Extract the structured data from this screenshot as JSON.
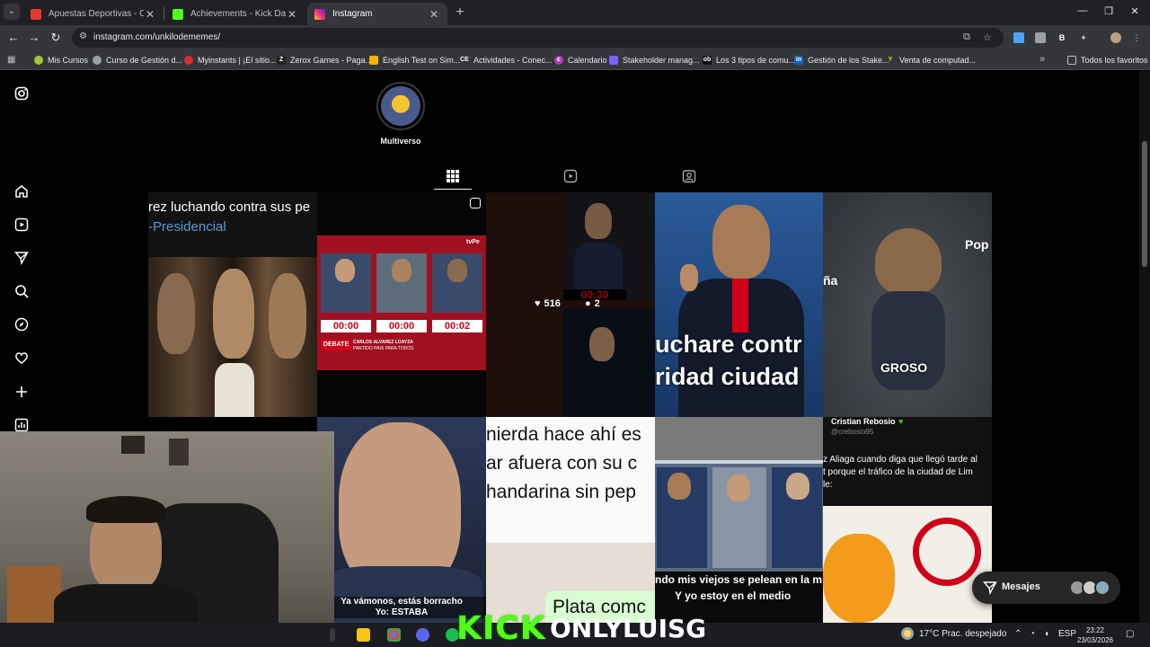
{
  "browser": {
    "tabs": [
      {
        "title": "Apuestas Deportivas - Casa de",
        "favicon_color": "#e53935",
        "active": false
      },
      {
        "title": "Achievements - Kick Dashboard",
        "favicon_color": "#53fc18",
        "active": false
      },
      {
        "title": "Instagram",
        "favicon_color": "#e1306c",
        "active": true
      }
    ],
    "url": "instagram.com/unkilodememes/",
    "bookmarks": [
      {
        "label": "Mis Cursos",
        "icon_color": "#a4c639",
        "glyph": ""
      },
      {
        "label": "Curso de Gestión d...",
        "icon_color": "#9aa0a6",
        "glyph": ""
      },
      {
        "label": "Myinstants | ¡El sitio...",
        "icon_color": "#d32f2f",
        "glyph": ""
      },
      {
        "label": "Zerox Games - Paga...",
        "icon_color": "#222222",
        "glyph": "Z"
      },
      {
        "label": "English Test on Sim...",
        "icon_color": "#f4b400",
        "glyph": ""
      },
      {
        "label": "Actividades - Conec...",
        "icon_color": "#35363a",
        "glyph": "CE"
      },
      {
        "label": "Calendario",
        "icon_color": "#b03fbf",
        "glyph": "c"
      },
      {
        "label": "Stakeholder manag...",
        "icon_color": "#7b61ff",
        "glyph": ""
      },
      {
        "label": "Los 3 tipos de comu...",
        "icon_color": "#111111",
        "glyph": "ob"
      },
      {
        "label": "Gestión de los Stake...",
        "icon_color": "#0a66c2",
        "glyph": "in"
      },
      {
        "label": "Venta de computad...",
        "icon_color": "#f5d300",
        "glyph": "Y"
      }
    ],
    "all_bookmarks_label": "Todos los favoritos"
  },
  "instagram": {
    "highlight_label": "Multiverso",
    "grid_tabs": [
      "posts-grid-icon",
      "reels-icon",
      "tagged-icon"
    ],
    "posts": [
      {
        "texts": [
          "rez luchando contra sus pe",
          "-Presidencial"
        ]
      },
      {
        "texts": [
          "00:00",
          "00:00",
          "00:02",
          "DEBATE",
          "CARLOS ÁLVAREZ LOAYZA",
          "PARTIDO PAÍS PARA TODOS",
          "tvPe"
        ]
      },
      {
        "likes": "516",
        "comments": "2",
        "texts": [
          "00:30"
        ]
      },
      {
        "texts": [
          "uchare contr",
          "ridad ciudad"
        ]
      },
      {
        "texts": [
          "Pop",
          "ña",
          "GROSO"
        ]
      },
      {
        "texts": [
          "Ya vámonos, estás borracho",
          "Yo: ESTABA"
        ]
      },
      {
        "texts": [
          "nierda hace ahí es",
          "ar afuera con su c",
          "handarina sin pep",
          "Plata comc"
        ]
      },
      {
        "texts": [
          "ndo mis viejos se pelean en la m",
          "Y yo estoy en el medio"
        ]
      },
      {
        "author": "Cristian Rebosio",
        "handle": "@crebosio95",
        "texts": [
          "z Aliaga cuando diga que llegó tarde al",
          "t porque el tráfico de la ciudad de Lim",
          "le:"
        ]
      }
    ],
    "messages_label": "Mesajes"
  },
  "overlay": {
    "brand": "KICK",
    "channel": "ONLYLUISG"
  },
  "taskbar": {
    "weather": "17°C  Prac. despejado",
    "lang": "ESP",
    "time": "23:22",
    "date": "23/03/2026"
  }
}
